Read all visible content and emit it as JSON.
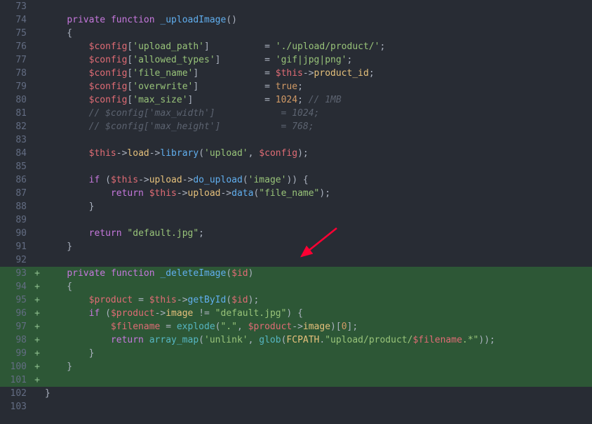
{
  "lines": [
    {
      "num": "73",
      "added": false,
      "tokens": [
        [
          "pn",
          "    "
        ]
      ]
    },
    {
      "num": "74",
      "added": false,
      "tokens": [
        [
          "pn",
          "    "
        ],
        [
          "kw",
          "private"
        ],
        [
          "pn",
          " "
        ],
        [
          "kw",
          "function"
        ],
        [
          "pn",
          " "
        ],
        [
          "fn",
          "_uploadImage"
        ],
        [
          "pn",
          "()"
        ]
      ]
    },
    {
      "num": "75",
      "added": false,
      "tokens": [
        [
          "pn",
          "    {"
        ]
      ]
    },
    {
      "num": "76",
      "added": false,
      "tokens": [
        [
          "pn",
          "        "
        ],
        [
          "var",
          "$config"
        ],
        [
          "pn",
          "["
        ],
        [
          "str",
          "'upload_path'"
        ],
        [
          "pn",
          "]          = "
        ],
        [
          "str",
          "'./upload/product/'"
        ],
        [
          "pn",
          ";"
        ]
      ]
    },
    {
      "num": "77",
      "added": false,
      "tokens": [
        [
          "pn",
          "        "
        ],
        [
          "var",
          "$config"
        ],
        [
          "pn",
          "["
        ],
        [
          "str",
          "'allowed_types'"
        ],
        [
          "pn",
          "]        = "
        ],
        [
          "str",
          "'gif|jpg|png'"
        ],
        [
          "pn",
          ";"
        ]
      ]
    },
    {
      "num": "78",
      "added": false,
      "tokens": [
        [
          "pn",
          "        "
        ],
        [
          "var",
          "$config"
        ],
        [
          "pn",
          "["
        ],
        [
          "str",
          "'file_name'"
        ],
        [
          "pn",
          "]            = "
        ],
        [
          "var",
          "$this"
        ],
        [
          "op",
          "->"
        ],
        [
          "prop",
          "product_id"
        ],
        [
          "pn",
          ";"
        ]
      ]
    },
    {
      "num": "79",
      "added": false,
      "tokens": [
        [
          "pn",
          "        "
        ],
        [
          "var",
          "$config"
        ],
        [
          "pn",
          "["
        ],
        [
          "str",
          "'overwrite'"
        ],
        [
          "pn",
          "]            = "
        ],
        [
          "cnst",
          "true"
        ],
        [
          "pn",
          ";"
        ]
      ]
    },
    {
      "num": "80",
      "added": false,
      "tokens": [
        [
          "pn",
          "        "
        ],
        [
          "var",
          "$config"
        ],
        [
          "pn",
          "["
        ],
        [
          "str",
          "'max_size'"
        ],
        [
          "pn",
          "]             = "
        ],
        [
          "num",
          "1024"
        ],
        [
          "pn",
          ";"
        ],
        [
          "cmt",
          " // 1MB"
        ]
      ]
    },
    {
      "num": "81",
      "added": false,
      "tokens": [
        [
          "pn",
          "        "
        ],
        [
          "cmt",
          "// $config['max_width']            = 1024;"
        ]
      ]
    },
    {
      "num": "82",
      "added": false,
      "tokens": [
        [
          "pn",
          "        "
        ],
        [
          "cmt",
          "// $config['max_height']           = 768;"
        ]
      ]
    },
    {
      "num": "83",
      "added": false,
      "tokens": [
        [
          "pn",
          ""
        ]
      ]
    },
    {
      "num": "84",
      "added": false,
      "tokens": [
        [
          "pn",
          "        "
        ],
        [
          "var",
          "$this"
        ],
        [
          "op",
          "->"
        ],
        [
          "prop",
          "load"
        ],
        [
          "op",
          "->"
        ],
        [
          "meth",
          "library"
        ],
        [
          "pn",
          "("
        ],
        [
          "str",
          "'upload'"
        ],
        [
          "pn",
          ", "
        ],
        [
          "var",
          "$config"
        ],
        [
          "pn",
          ");"
        ]
      ]
    },
    {
      "num": "85",
      "added": false,
      "tokens": [
        [
          "pn",
          ""
        ]
      ]
    },
    {
      "num": "86",
      "added": false,
      "tokens": [
        [
          "pn",
          "        "
        ],
        [
          "kw",
          "if"
        ],
        [
          "pn",
          " ("
        ],
        [
          "var",
          "$this"
        ],
        [
          "op",
          "->"
        ],
        [
          "prop",
          "upload"
        ],
        [
          "op",
          "->"
        ],
        [
          "meth",
          "do_upload"
        ],
        [
          "pn",
          "("
        ],
        [
          "str",
          "'image'"
        ],
        [
          "pn",
          ")) {"
        ]
      ]
    },
    {
      "num": "87",
      "added": false,
      "tokens": [
        [
          "pn",
          "            "
        ],
        [
          "kw",
          "return"
        ],
        [
          "pn",
          " "
        ],
        [
          "var",
          "$this"
        ],
        [
          "op",
          "->"
        ],
        [
          "prop",
          "upload"
        ],
        [
          "op",
          "->"
        ],
        [
          "meth",
          "data"
        ],
        [
          "pn",
          "("
        ],
        [
          "str",
          "\"file_name\""
        ],
        [
          "pn",
          ");"
        ]
      ]
    },
    {
      "num": "88",
      "added": false,
      "tokens": [
        [
          "pn",
          "        }"
        ]
      ]
    },
    {
      "num": "89",
      "added": false,
      "tokens": [
        [
          "pn",
          ""
        ]
      ]
    },
    {
      "num": "90",
      "added": false,
      "tokens": [
        [
          "pn",
          "        "
        ],
        [
          "kw",
          "return"
        ],
        [
          "pn",
          " "
        ],
        [
          "str",
          "\"default.jpg\""
        ],
        [
          "pn",
          ";"
        ]
      ]
    },
    {
      "num": "91",
      "added": false,
      "tokens": [
        [
          "pn",
          "    }"
        ]
      ]
    },
    {
      "num": "92",
      "added": false,
      "tokens": [
        [
          "pn",
          ""
        ]
      ]
    },
    {
      "num": "93",
      "added": true,
      "tokens": [
        [
          "pn",
          "    "
        ],
        [
          "kw",
          "private"
        ],
        [
          "pn",
          " "
        ],
        [
          "kw",
          "function"
        ],
        [
          "pn",
          " "
        ],
        [
          "fn",
          "_deleteImage"
        ],
        [
          "pn",
          "("
        ],
        [
          "var",
          "$id"
        ],
        [
          "pn",
          ")"
        ]
      ]
    },
    {
      "num": "94",
      "added": true,
      "tokens": [
        [
          "pn",
          "    {"
        ]
      ]
    },
    {
      "num": "95",
      "added": true,
      "tokens": [
        [
          "pn",
          "        "
        ],
        [
          "var",
          "$product"
        ],
        [
          "pn",
          " = "
        ],
        [
          "var",
          "$this"
        ],
        [
          "op",
          "->"
        ],
        [
          "meth",
          "getById"
        ],
        [
          "pn",
          "("
        ],
        [
          "var",
          "$id"
        ],
        [
          "pn",
          ");"
        ]
      ]
    },
    {
      "num": "96",
      "added": true,
      "tokens": [
        [
          "pn",
          "        "
        ],
        [
          "kw",
          "if"
        ],
        [
          "pn",
          " ("
        ],
        [
          "var",
          "$product"
        ],
        [
          "op",
          "->"
        ],
        [
          "prop",
          "image"
        ],
        [
          "pn",
          " "
        ],
        [
          "op",
          "!="
        ],
        [
          "pn",
          " "
        ],
        [
          "str",
          "\"default.jpg\""
        ],
        [
          "pn",
          ") {"
        ]
      ]
    },
    {
      "num": "97",
      "added": true,
      "tokens": [
        [
          "pn",
          "            "
        ],
        [
          "var",
          "$filename"
        ],
        [
          "pn",
          " = "
        ],
        [
          "call",
          "explode"
        ],
        [
          "pn",
          "("
        ],
        [
          "str",
          "\".\""
        ],
        [
          "pn",
          ", "
        ],
        [
          "var",
          "$product"
        ],
        [
          "op",
          "->"
        ],
        [
          "prop",
          "image"
        ],
        [
          "pn",
          ")["
        ],
        [
          "num",
          "0"
        ],
        [
          "pn",
          "];"
        ]
      ]
    },
    {
      "num": "98",
      "added": true,
      "tokens": [
        [
          "pn",
          "            "
        ],
        [
          "kw",
          "return"
        ],
        [
          "pn",
          " "
        ],
        [
          "call",
          "array_map"
        ],
        [
          "pn",
          "("
        ],
        [
          "str",
          "'unlink'"
        ],
        [
          "pn",
          ", "
        ],
        [
          "call",
          "glob"
        ],
        [
          "pn",
          "("
        ],
        [
          "prop",
          "FCPATH"
        ],
        [
          "op",
          "."
        ],
        [
          "str",
          "\"upload/product/"
        ],
        [
          "var",
          "$filename"
        ],
        [
          "str",
          ".*\""
        ],
        [
          "pn",
          "));"
        ]
      ]
    },
    {
      "num": "99",
      "added": true,
      "tokens": [
        [
          "pn",
          "        }"
        ]
      ]
    },
    {
      "num": "100",
      "added": true,
      "tokens": [
        [
          "pn",
          "    }"
        ]
      ]
    },
    {
      "num": "101",
      "added": true,
      "tokens": [
        [
          "pn",
          ""
        ]
      ]
    },
    {
      "num": "102",
      "added": false,
      "tokens": [
        [
          "pn",
          "}"
        ]
      ]
    },
    {
      "num": "103",
      "added": false,
      "tokens": [
        [
          "pn",
          ""
        ]
      ]
    }
  ],
  "added_marker": "+",
  "arrow_color": "#ff0033"
}
